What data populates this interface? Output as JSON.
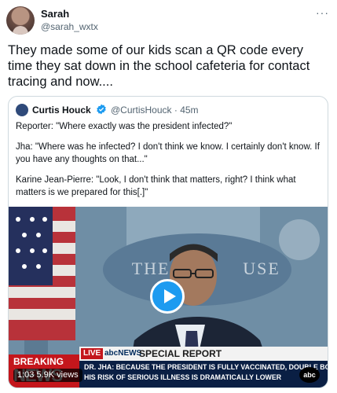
{
  "author": {
    "name": "Sarah",
    "handle": "@sarah_wxtx",
    "more": "···"
  },
  "tweet": {
    "text": "They made some of our kids scan a QR code every time they sat down in the school cafeteria for contact tracing and now...."
  },
  "quote": {
    "name": "Curtis Houck",
    "handle": "@CurtisHouck",
    "separator": "·",
    "time": "45m",
    "meta": "@CurtisHouck · 45m",
    "paragraphs": [
      "Reporter: \"Where exactly was the president infected?\"",
      "Jha: \"Where was he infected? I don't think we know. I certainly don't know. If you have any thoughts on that...\"",
      "Karine Jean-Pierre: \"Look, I don't think that matters, right? I think what matters is we prepared for this[.]\""
    ]
  },
  "video": {
    "podium_text": "THE WHITE HOUSE",
    "podium_visible_left": "THE WH",
    "podium_visible_right": "USE",
    "duration": "1:03",
    "views": "5.9K views",
    "time_views": "1:03  5.9K views",
    "breaking_line1": "BREAKING",
    "breaking_line2": "NEWS",
    "live": "LIVE",
    "network": "abcNEWS",
    "special_report": "SPECIAL REPORT",
    "crawl_line1": "DR. JHA: BECAUSE THE PRESIDENT IS FULLY VACCINATED, DOUBLE BOOSTED,",
    "crawl_line2": "HIS RISK OF SERIOUS ILLNESS IS DRAMATICALLY LOWER",
    "logo": "abc"
  },
  "colors": {
    "accent": "#1d9bf0",
    "breaking_red": "#c4161c",
    "crawl_navy": "#0a1f44"
  }
}
